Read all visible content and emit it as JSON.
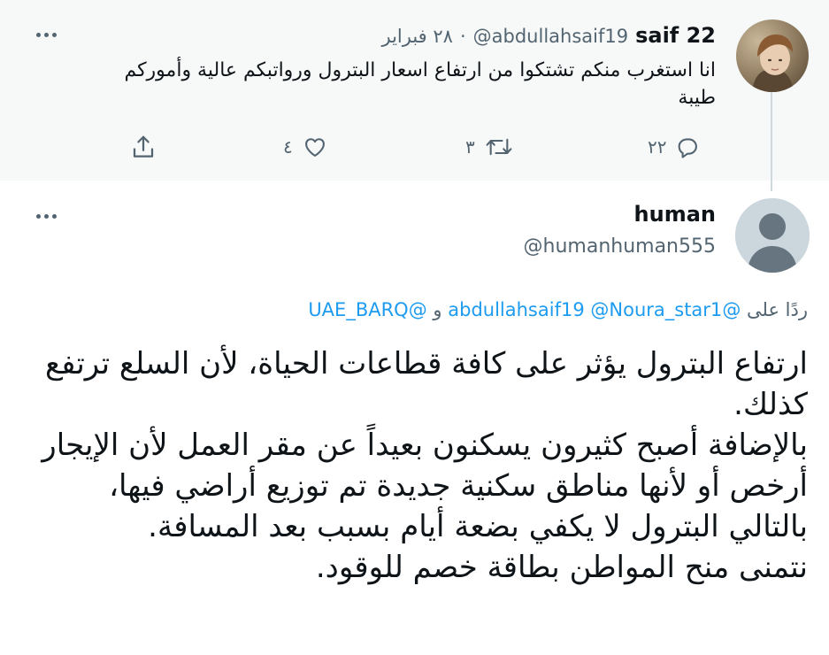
{
  "parent_tweet": {
    "display_name": "saif 22",
    "handle": "@abdullahsaif19",
    "separator": "·",
    "date": "٢٨ فبراير",
    "text": "انا استغرب منكم تشتكوا من ارتفاع اسعار البترول ورواتبكم عالية وأموركم طيبة",
    "reply_count": "٢٢",
    "retweet_count": "٣",
    "like_count": "٤"
  },
  "reply_tweet": {
    "display_name": "human",
    "handle": "@humanhuman555",
    "replying_to_label": "ردًا على",
    "mentions": [
      "@abdullahsaif19",
      "@Noura_star1",
      "@UAE_BARQ"
    ],
    "and_word": "و",
    "body_lines": [
      "ارتفاع البترول يؤثر على كافة قطاعات الحياة، لأن السلع ترتفع كذلك.",
      "بالإضافة أصبح كثيرون يسكنون بعيداً عن مقر العمل لأن الإيجار أرخص أو لأنها مناطق سكنية جديدة تم توزيع أراضي فيها، بالتالي البترول لا يكفي بضعة أيام بسبب بعد المسافة.",
      "نتمنى منح المواطن بطاقة خصم للوقود."
    ]
  },
  "icons": {
    "more": "more-horizontal-icon",
    "reply": "reply-bubble-icon",
    "retweet": "retweet-icon",
    "like": "heart-icon",
    "share": "share-icon"
  },
  "colors": {
    "accent": "#1d9bf0",
    "secondary_text": "#536471",
    "parent_background": "#f7f9f9"
  }
}
